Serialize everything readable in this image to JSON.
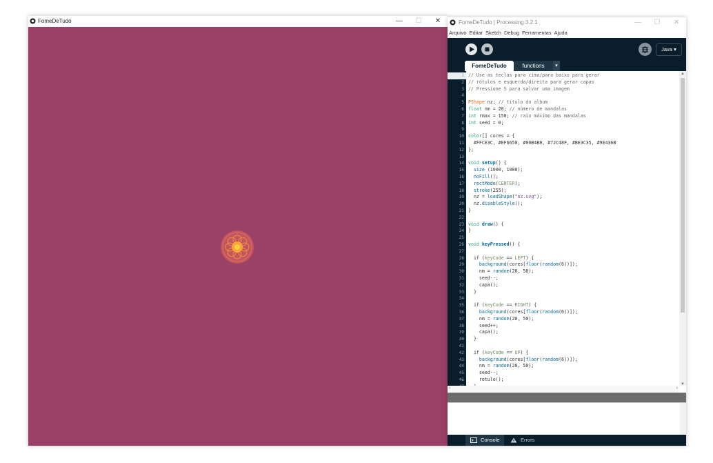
{
  "sketch_window": {
    "title": "FomeDeTudo",
    "controls": {
      "minimize": "—",
      "maximize": "☐",
      "close": "✕"
    },
    "background_color": "#9B4067"
  },
  "ide_window": {
    "title": "FomeDeTudo | Processing 3.2.1",
    "controls": {
      "minimize": "—",
      "maximize": "☐",
      "close": "✕"
    },
    "menu": [
      "Arquivo",
      "Editar",
      "Sketch",
      "Debug",
      "Ferramentas",
      "Ajuda"
    ],
    "toolbar": {
      "mode_label": "Java ▾",
      "run_icon": "play-icon",
      "stop_icon": "stop-icon",
      "debug_icon": "debugger-icon"
    },
    "tabs": [
      {
        "label": "FomeDeTudo",
        "active": true
      },
      {
        "label": "functions",
        "active": false
      }
    ],
    "tab_menu": "▾",
    "current_line": 1,
    "footer": {
      "console_label": "Console",
      "errors_label": "Errors"
    },
    "colors": {
      "toolbar_bg": "#0A1D2B",
      "comment": "#666666",
      "keyword": "#33997E",
      "type": "#E2661A",
      "function": "#006699"
    }
  },
  "code_lines": [
    "// Use as teclas para cima/para baixo para gerar",
    "// rótulos e esquerda/direita para gerar capas",
    "// Pressione S para salvar uma imagem",
    "",
    "PShape nz; // título do album",
    "float nm = 20; // número de mandalas",
    "int rmax = 150; // raio máximo das mandalas",
    "int seed = 0;",
    "",
    "color[] cores = {",
    "  #FFCE3C, #EF6650, #00B4B8, #72C48F, #BE3C35, #9E436B",
    "};",
    "",
    "void setup() {",
    "  size (1000, 1000);",
    "  noFill();",
    "  rectMode(CENTER);",
    "  stroke(255);",
    "  nz = loadShape(\"nz.svg\");",
    "  nz.disableStyle();",
    "}",
    "",
    "void draw() {",
    "}",
    "",
    "void keyPressed() {",
    "",
    "  if (keyCode == LEFT) {",
    "    background(cores[floor(random(6))]);",
    "    nm = random(20, 50);",
    "    seed--;",
    "    capa();",
    "  }",
    "",
    "  if (keyCode == RIGHT) {",
    "    background(cores[floor(random(6))]);",
    "    nm = random(20, 50);",
    "    seed++;",
    "    capa();",
    "  }",
    "",
    "  if (keyCode == UP) {",
    "    background(cores[floor(random(6))]);",
    "    nm = random(20, 50);",
    "    seed--;",
    "    rotulo();",
    "  }"
  ]
}
